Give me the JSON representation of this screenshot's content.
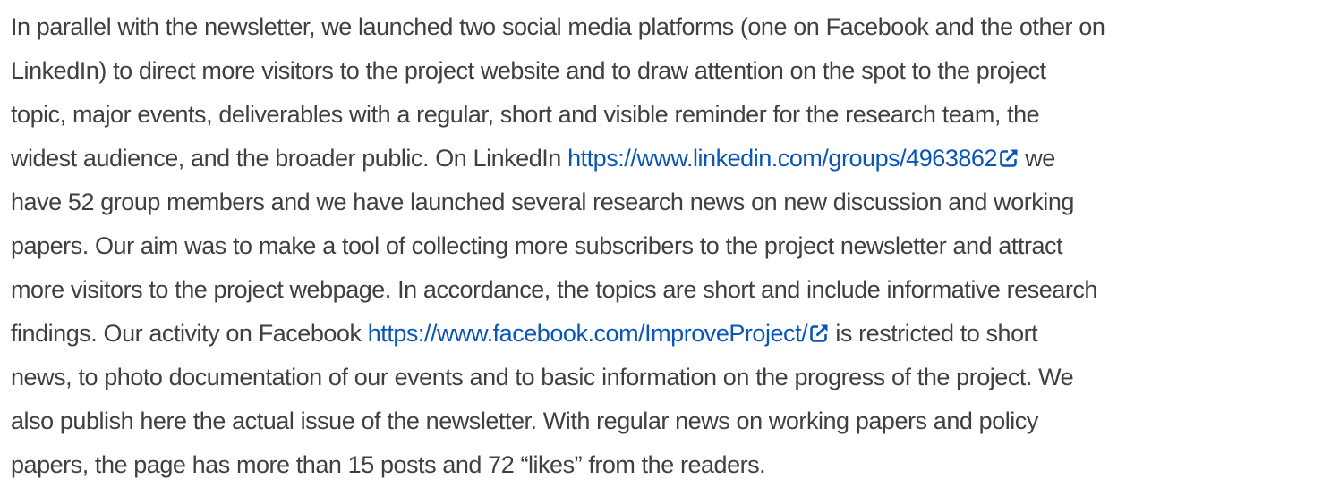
{
  "paragraph": {
    "line1": "In parallel with the newsletter, we launched two social media platforms (one on Facebook and the other on",
    "line2": "LinkedIn) to direct more visitors to the project website and to draw attention on the spot to the project",
    "line3": "topic, major events, deliverables with a regular, short and visible reminder for the research team, the",
    "line4_before": "widest audience, and the broader public. On LinkedIn ",
    "linkedin_url": "https://www.linkedin.com/groups/4963862",
    "line4_after": " we",
    "line5": "have 52 group members and we have launched several research news on new discussion and working",
    "line6": "papers. Our aim was to make a tool of collecting more subscribers to the project newsletter and attract",
    "line7": "more visitors to the project webpage. In accordance, the topics are short and include informative research",
    "line8_before": "findings. Our activity on Facebook ",
    "facebook_url": "https://www.facebook.com/ImproveProject/",
    "line8_after": " is restricted to short",
    "line9": "news, to photo documentation of our events and to basic information on the progress of the project. We",
    "line10": "also publish here the actual issue of the newsletter. With regular news on working papers and policy",
    "line11": "papers, the page has more than 15 posts and 72 “likes” from the readers."
  },
  "icons": {
    "external_link": "external-link-icon"
  },
  "colors": {
    "text": "#404040",
    "link": "#0a56b8"
  }
}
